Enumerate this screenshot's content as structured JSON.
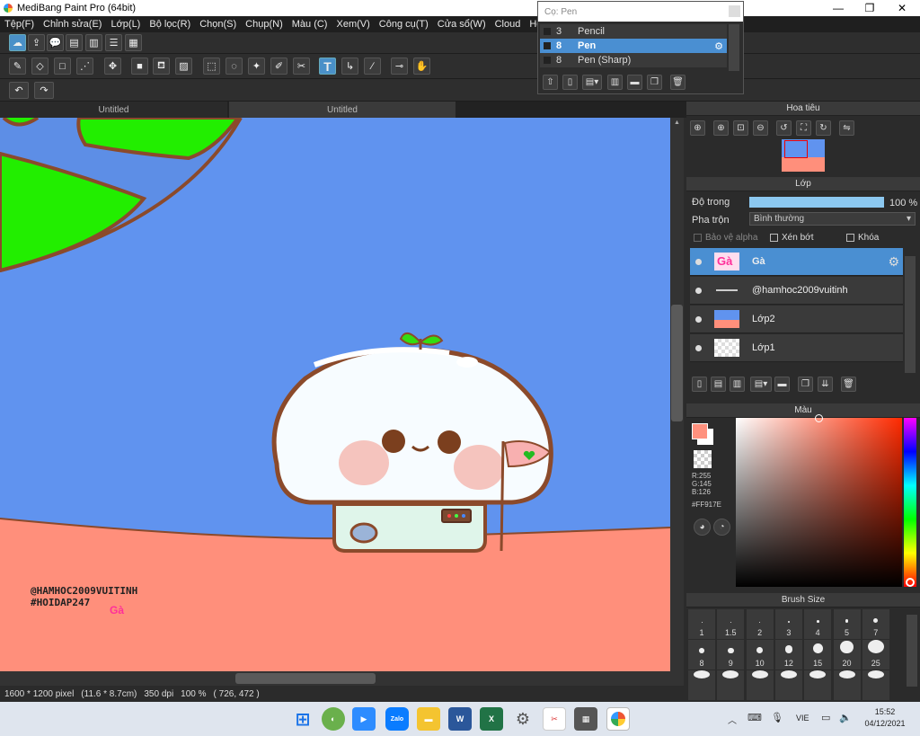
{
  "window": {
    "title": "MediBang Paint Pro (64bit)"
  },
  "menu": [
    "Tệp(F)",
    "Chỉnh sửa(E)",
    "Lớp(L)",
    "Bộ lọc(R)",
    "Chọn(S)",
    "Chụp(N)",
    "Màu (C)",
    "Xem(V)",
    "Công cụ(T)",
    "Cửa sổ(W)",
    "Cloud",
    "Help"
  ],
  "canvas_tabs": [
    "Untitled",
    "Untitled"
  ],
  "canvas_text": {
    "handle": "@HAMHOC2009VUITINH",
    "hashtag": "#HOIDAP247",
    "ga": "Gà"
  },
  "status": {
    "size": "1600 * 1200 pixel",
    "cm": "(11.6 * 8.7cm)",
    "dpi": "350 dpi",
    "zoom": "100 %",
    "coords": "( 726, 472 )"
  },
  "brush_popup": {
    "title": "Cọ: Pen",
    "items": [
      {
        "size": "3",
        "name": "Pencil"
      },
      {
        "size": "8",
        "name": "Pen",
        "selected": true
      },
      {
        "size": "8",
        "name": "Pen (Sharp)"
      }
    ]
  },
  "navigator": {
    "title": "Hoa tiêu"
  },
  "layers": {
    "title": "Lớp",
    "opacity_label": "Độ trong",
    "opacity_value": "100 %",
    "opacity_fraction": 1.0,
    "blend_label": "Pha trộn",
    "blend_value": "Bình thường",
    "alpha_label": "Bảo vệ alpha",
    "clip_label": "Xén bớt",
    "lock_label": "Khóa",
    "items": [
      {
        "name": "Gà",
        "selected": true
      },
      {
        "name": "@hamhoc2009vuitinh"
      },
      {
        "name": "Lớp2"
      },
      {
        "name": "Lớp1"
      }
    ]
  },
  "color": {
    "title": "Màu",
    "r": "R:255",
    "g": "G:145",
    "b": "B:126",
    "hex": "#FF917E",
    "foreground": "#FF917E"
  },
  "brush_size": {
    "title": "Brush Size",
    "sizes": [
      "1",
      "1.5",
      "2",
      "3",
      "4",
      "5",
      "7",
      "8",
      "9",
      "10",
      "12",
      "15",
      "20",
      "25"
    ]
  },
  "taskbar": {
    "lang": "VIE",
    "time": "15:52",
    "date": "04/12/2021"
  },
  "colors": {
    "sky": "#6093EF",
    "ground": "#FF8F7B",
    "land": "#22EE00",
    "accent": "#4A8FD2"
  }
}
